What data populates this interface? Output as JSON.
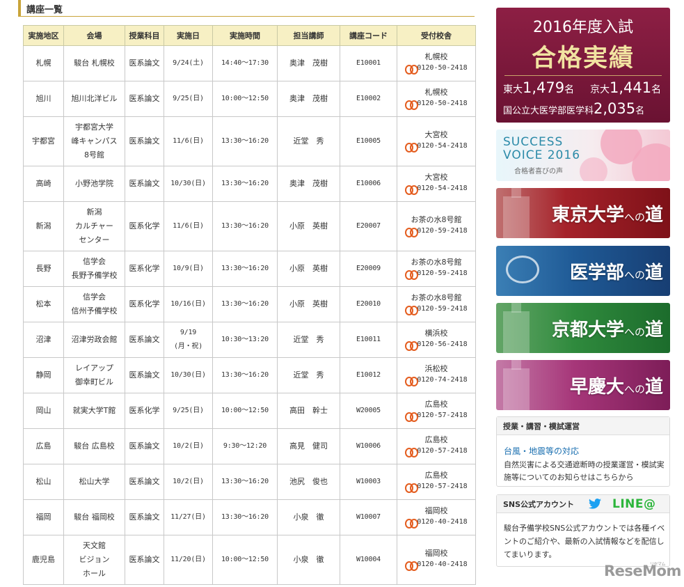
{
  "section": {
    "title": "講座一覧"
  },
  "table": {
    "headers": [
      "実施地区",
      "会場",
      "授業科目",
      "実施日",
      "実施時間",
      "担当講師",
      "講座コード",
      "受付校舎"
    ],
    "rows": [
      {
        "area": "札幌",
        "venue": [
          "駿台 札幌校"
        ],
        "subject": "医系論文",
        "date": [
          "9/24(土)"
        ],
        "time": "14:40〜17:30",
        "teacher": "奥津　茂樹",
        "code": "E10001",
        "school": "札幌校",
        "tel": "0120-50-2418"
      },
      {
        "area": "旭川",
        "venue": [
          "旭川北洋ビル"
        ],
        "subject": "医系論文",
        "date": [
          "9/25(日)"
        ],
        "time": "10:00〜12:50",
        "teacher": "奥津　茂樹",
        "code": "E10002",
        "school": "札幌校",
        "tel": "0120-50-2418"
      },
      {
        "area": "宇都宮",
        "venue": [
          "宇都宮大学",
          "峰キャンパス",
          "8号館"
        ],
        "subject": "医系論文",
        "date": [
          "11/6(日)"
        ],
        "time": "13:30〜16:20",
        "teacher": "近堂　秀",
        "code": "E10005",
        "school": "大宮校",
        "tel": "0120-54-2418"
      },
      {
        "area": "高崎",
        "venue": [
          "小野池学院"
        ],
        "subject": "医系論文",
        "date": [
          "10/30(日)"
        ],
        "time": "13:30〜16:20",
        "teacher": "奥津　茂樹",
        "code": "E10006",
        "school": "大宮校",
        "tel": "0120-54-2418"
      },
      {
        "area": "新潟",
        "venue": [
          "新潟",
          "カルチャー",
          "センター"
        ],
        "subject": "医系化学",
        "date": [
          "11/6(日)"
        ],
        "time": "13:30〜16:20",
        "teacher": "小原　英樹",
        "code": "E20007",
        "school": "お茶の水8号館",
        "tel": "0120-59-2418"
      },
      {
        "area": "長野",
        "venue": [
          "信学会",
          "長野予備学校"
        ],
        "subject": "医系化学",
        "date": [
          "10/9(日)"
        ],
        "time": "13:30〜16:20",
        "teacher": "小原　英樹",
        "code": "E20009",
        "school": "お茶の水8号館",
        "tel": "0120-59-2418"
      },
      {
        "area": "松本",
        "venue": [
          "信学会",
          "信州予備学校"
        ],
        "subject": "医系化学",
        "date": [
          "10/16(日)"
        ],
        "time": "13:30〜16:20",
        "teacher": "小原　英樹",
        "code": "E20010",
        "school": "お茶の水8号館",
        "tel": "0120-59-2418"
      },
      {
        "area": "沼津",
        "venue": [
          "沼津労政会館"
        ],
        "subject": "医系論文",
        "date": [
          "9/19",
          "(月・祝)"
        ],
        "time": "10:30〜13:20",
        "teacher": "近堂　秀",
        "code": "E10011",
        "school": "横浜校",
        "tel": "0120-56-2418"
      },
      {
        "area": "静岡",
        "venue": [
          "レイアップ",
          "御幸町ビル"
        ],
        "subject": "医系論文",
        "date": [
          "10/30(日)"
        ],
        "time": "13:30〜16:20",
        "teacher": "近堂　秀",
        "code": "E10012",
        "school": "浜松校",
        "tel": "0120-74-2418"
      },
      {
        "area": "岡山",
        "venue": [
          "就実大学T館"
        ],
        "subject": "医系化学",
        "date": [
          "9/25(日)"
        ],
        "time": "10:00〜12:50",
        "teacher": "高田　幹士",
        "code": "W20005",
        "school": "広島校",
        "tel": "0120-57-2418"
      },
      {
        "area": "広島",
        "venue": [
          "駿台 広島校"
        ],
        "subject": "医系論文",
        "date": [
          "10/2(日)"
        ],
        "time": "9:30〜12:20",
        "teacher": "高見　健司",
        "code": "W10006",
        "school": "広島校",
        "tel": "0120-57-2418"
      },
      {
        "area": "松山",
        "venue": [
          "松山大学"
        ],
        "subject": "医系論文",
        "date": [
          "10/2(日)"
        ],
        "time": "13:30〜16:20",
        "teacher": "池尻　俊也",
        "code": "W10003",
        "school": "広島校",
        "tel": "0120-57-2418"
      },
      {
        "area": "福岡",
        "venue": [
          "駿台 福岡校"
        ],
        "subject": "医系論文",
        "date": [
          "11/27(日)"
        ],
        "time": "13:30〜16:20",
        "teacher": "小泉　徹",
        "code": "W10007",
        "school": "福岡校",
        "tel": "0120-40-2418"
      },
      {
        "area": "鹿児島",
        "venue": [
          "天文館",
          "ビジョン",
          "ホール"
        ],
        "subject": "医系論文",
        "date": [
          "11/20(日)"
        ],
        "time": "10:00〜12:50",
        "teacher": "小泉　徹",
        "code": "W10004",
        "school": "福岡校",
        "tel": "0120-40-2418"
      }
    ]
  },
  "banners": {
    "results": {
      "year": "2016年度入試",
      "headline": "合格実績",
      "todai_label": "東大",
      "todai_num": "1,479",
      "todai_unit": "名",
      "kyodai_label": "京大",
      "kyodai_num": "1,441",
      "kyodai_unit": "名",
      "med_label": "国公立大医学部医学科",
      "med_num": "2,035",
      "med_unit": "名"
    },
    "voice": {
      "line1": "SUCCESS",
      "line2": "VOICE 2016",
      "line3": "合格者喜びの声"
    },
    "tokyo": {
      "main": "東京大学",
      "suffix": "への",
      "road": "道"
    },
    "medical": {
      "main": "医学部",
      "suffix": "への",
      "road": "道"
    },
    "kyoto": {
      "main": "京都大学",
      "suffix": "への",
      "road": "道"
    },
    "waseda": {
      "main": "早慶大",
      "suffix": "への",
      "road": "道"
    }
  },
  "ops_box": {
    "title": "授業・講習・模試運営",
    "link": "台風・地震等の対応",
    "text": "自然災害による交通遮断時の授業運営・模試実施等についてのお知らせはこちらから"
  },
  "sns_box": {
    "title": "SNS公式アカウント",
    "line_logo": "LINE@",
    "text": "駿台予備学校SNS公式アカウントでは各種イベントのご紹介や、最新の入試情報などを配信してまいります。"
  },
  "watermark": {
    "text": "ReseMom",
    "sub": "リセマム"
  },
  "colors": {
    "header_bg": "#f7f0c4",
    "accent_gold": "#c9a43a",
    "tel_icon": "#e45d1f",
    "link": "#1a6fb0",
    "line_green": "#2cb53b"
  }
}
